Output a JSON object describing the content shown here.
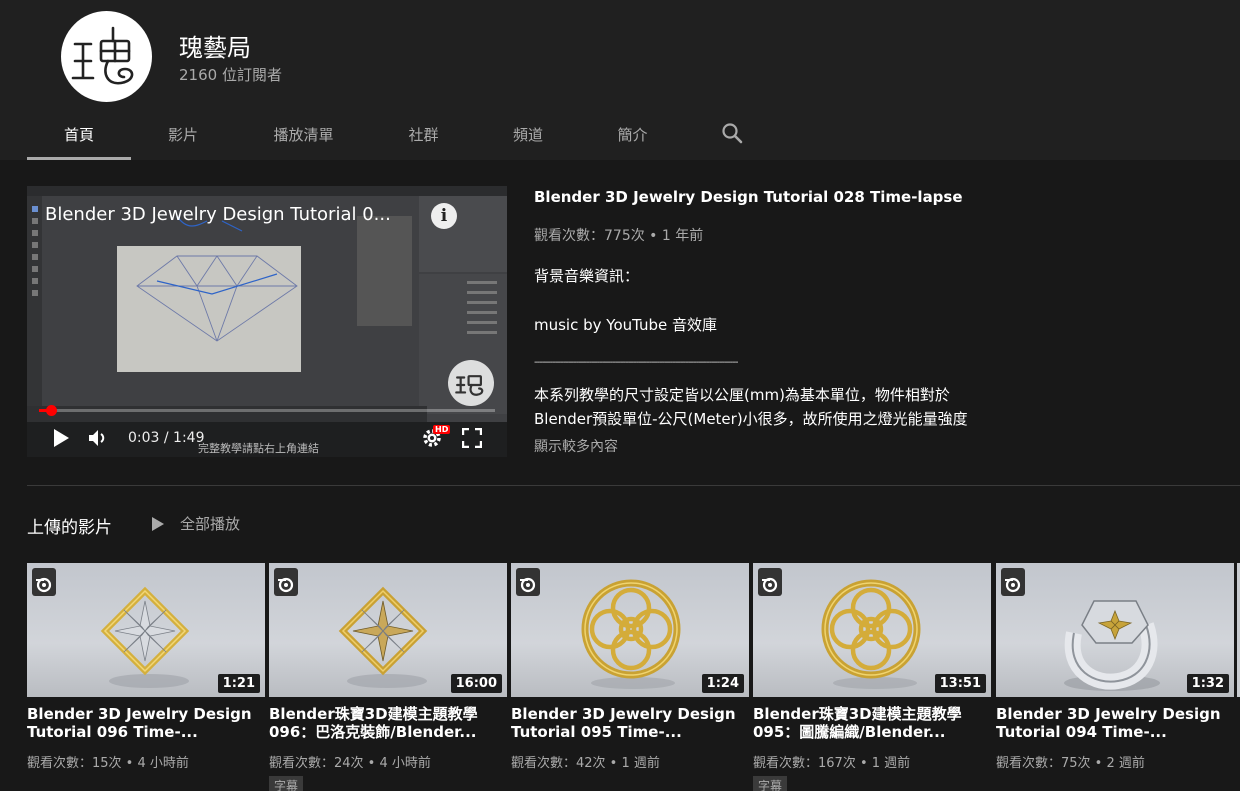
{
  "channel": {
    "name": "瑰藝局",
    "subscribers": "2160 位訂閱者"
  },
  "tabs": [
    {
      "label": "首頁",
      "active": true
    },
    {
      "label": "影片"
    },
    {
      "label": "播放清單"
    },
    {
      "label": "社群"
    },
    {
      "label": "頻道"
    },
    {
      "label": "簡介"
    }
  ],
  "featured": {
    "overlay_title": "Blender 3D Jewelry Design Tutorial 0...",
    "time": "0:03 / 1:49",
    "subtitle_overlay": "完整教學請點右上角連結",
    "hd_label": "HD",
    "progress": 0.027,
    "title": "Blender 3D Jewelry Design Tutorial 028 Time-lapse",
    "meta": "觀看次數：775次 • 1 年前",
    "description": [
      "背景音樂資訊：",
      "music by YouTube 音效庫",
      "------------------------------------------------------------------------------",
      "本系列教學的尺寸設定皆以公厘(mm)為基本單位，物件相對於",
      "Blender預設單位-公尺(Meter)小很多，故所使用之燈光能量強度"
    ],
    "show_more": "顯示較多內容"
  },
  "shelf": {
    "title": "上傳的影片",
    "play_all": "全部播放"
  },
  "videos": [
    {
      "title": "Blender 3D Jewelry Design Tutorial 096 Time-...",
      "meta": "觀看次數：15次 • 4 小時前",
      "duration": "1:21",
      "kind": "diamond"
    },
    {
      "title": "Blender珠寶3D建模主題教學 096：巴洛克裝飾/Blender...",
      "meta": "觀看次數：24次 • 4 小時前",
      "duration": "16:00",
      "kind": "diamond",
      "badge": "字幕"
    },
    {
      "title": "Blender 3D Jewelry Design Tutorial 095 Time-...",
      "meta": "觀看次數：42次 • 1 週前",
      "duration": "1:24",
      "kind": "medallion"
    },
    {
      "title": "Blender珠寶3D建模主題教學 095：圖騰編織/Blender...",
      "meta": "觀看次數：167次 • 1 週前",
      "duration": "13:51",
      "kind": "medallion",
      "badge": "字幕"
    },
    {
      "title": "Blender 3D Jewelry Design Tutorial 094 Time-...",
      "meta": "觀看次數：75次 • 2 週前",
      "duration": "1:32",
      "kind": "ring"
    }
  ],
  "icons": {
    "search": "search-icon",
    "play": "play-icon",
    "volume": "volume-icon",
    "settings": "gear-icon",
    "fullscreen": "fullscreen-icon",
    "info": "info-icon",
    "blender": "blender-logo-icon"
  },
  "colors": {
    "background": "#181818",
    "header": "#202020",
    "progress": "#ff0000",
    "gold": "#d9b43a"
  }
}
